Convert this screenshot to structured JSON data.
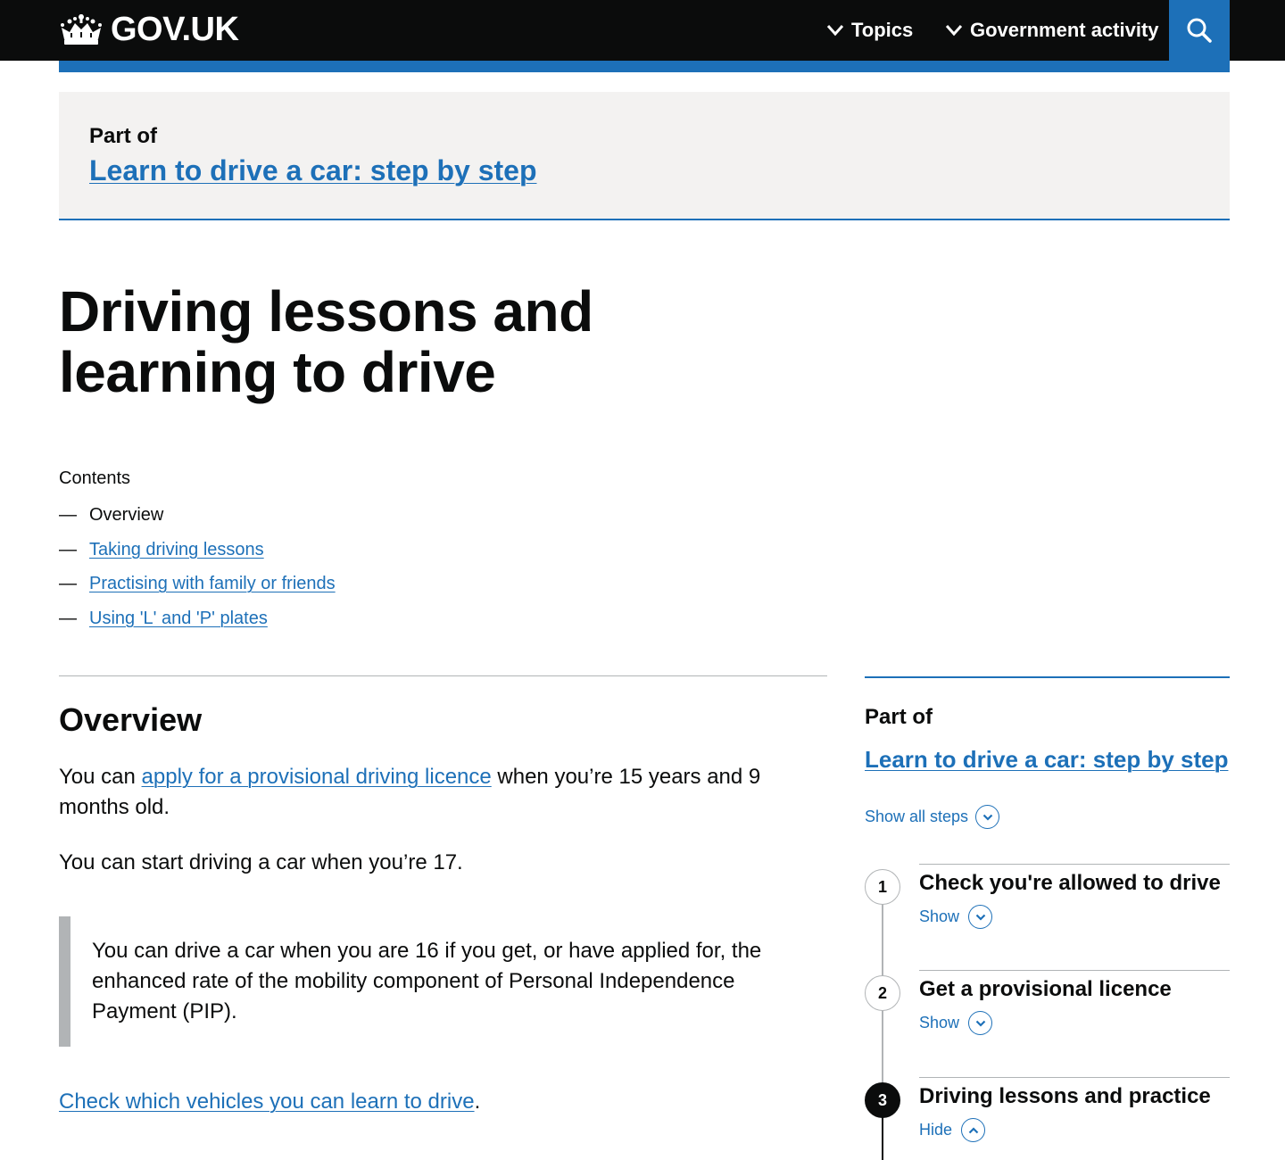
{
  "header": {
    "logo_text": "GOV.UK",
    "nav": [
      {
        "label": "Topics",
        "icon": "chevron-down-icon"
      },
      {
        "label": "Government activity",
        "icon": "chevron-down-icon"
      }
    ],
    "search_icon": "search-icon"
  },
  "colors": {
    "header_bg": "#0b0c0c",
    "brand_blue": "#1d70b8",
    "banner_bg": "#f3f2f1",
    "text": "#0b0c0c",
    "border_grey": "#b1b4b6"
  },
  "part_of_banner": {
    "label": "Part of",
    "link": "Learn to drive a car: step by step"
  },
  "page_title": "Driving lessons and learning to drive",
  "contents": {
    "label": "Contents",
    "items": [
      {
        "label": "Overview",
        "current": true
      },
      {
        "label": "Taking driving lessons",
        "current": false
      },
      {
        "label": "Practising with family or friends",
        "current": false
      },
      {
        "label": "Using 'L' and 'P' plates",
        "current": false
      }
    ]
  },
  "overview": {
    "heading": "Overview",
    "p1_before": "You can ",
    "p1_link": "apply for a provisional driving licence",
    "p1_after": " when you’re 15 years and 9 months old.",
    "p2": "You can start driving a car when you’re 17.",
    "inset": "You can drive a car when you are 16 if you get, or have applied for, the enhanced rate of the mobility component of Personal Independence Payment (PIP).",
    "p3_link": "Check which vehicles you can learn to drive",
    "p3_after": "."
  },
  "sidebar": {
    "part_of_label": "Part of",
    "link": "Learn to drive a car: step by step",
    "show_all": "Show all steps",
    "steps": [
      {
        "number": "1",
        "title": "Check you're allowed to drive",
        "toggle": "Show",
        "expanded": false
      },
      {
        "number": "2",
        "title": "Get a provisional licence",
        "toggle": "Show",
        "expanded": false
      },
      {
        "number": "3",
        "title": "Driving lessons and practice",
        "toggle": "Hide",
        "expanded": true
      }
    ]
  }
}
